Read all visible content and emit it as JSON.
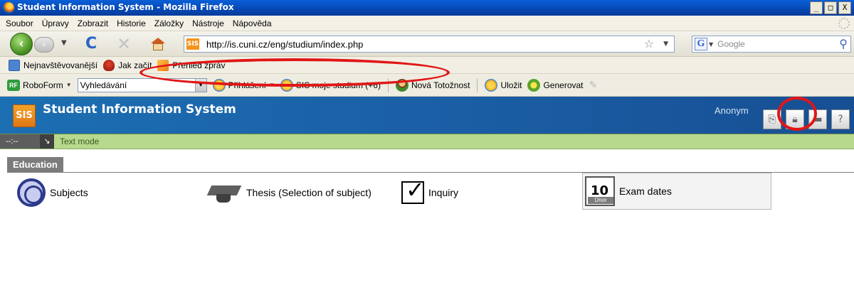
{
  "window": {
    "title": "Student Information System - Mozilla Firefox",
    "controls": [
      "_",
      "□",
      "X"
    ]
  },
  "menu": {
    "items": [
      "Soubor",
      "Úpravy",
      "Zobrazit",
      "Historie",
      "Záložky",
      "Nástroje",
      "Nápověda"
    ]
  },
  "nav": {
    "url": "http://is.cuni.cz/eng/studium/index.php",
    "site_icon_text": "SIS",
    "search_engine": "Google",
    "search_icon_letter": "G"
  },
  "bookmarks": {
    "items": [
      "Nejnavštěvovanější",
      "Jak začít",
      "Přehled zpráv"
    ]
  },
  "roboform": {
    "brand": "RoboForm",
    "search_value": "Vyhledávání",
    "login": "Přihlášení",
    "sis": "SIS moje studium (+6)",
    "new_identity": "Nová Totožnost",
    "save": "Uložit",
    "generate": "Generovat"
  },
  "sis": {
    "logo_text": "SIS",
    "title": "Student Information System",
    "user": "Anonym"
  },
  "textmode": {
    "dash": "--:--",
    "label": "Text mode"
  },
  "section": {
    "title": "Education"
  },
  "modules": {
    "subjects": "Subjects",
    "thesis": "Thesis (Selection of subject)",
    "inquiry": "Inquiry",
    "exam_dates": "Exam dates",
    "calendar_number": "10",
    "calendar_month": "Únor"
  },
  "colors": {
    "sis_header": "#1b5fa6",
    "annotation": "#e11616",
    "textmode_bar": "#b7d98d"
  }
}
